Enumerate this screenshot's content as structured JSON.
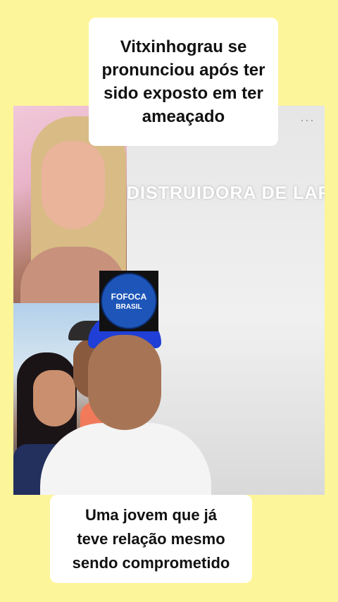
{
  "headline": {
    "lines": [
      "Vitxinhograu se",
      "pronunciou após ter",
      "sido exposto em ter",
      "ameaçado"
    ]
  },
  "video": {
    "wall_text": "DISTRUIDORA DE LAR.",
    "menu_icon": "more-dots-icon",
    "menu_glyph": "···"
  },
  "logo": {
    "line1": "FOFOCA",
    "line2": "BRASIL"
  },
  "caption": {
    "lines": [
      "Uma jovem que já",
      "teve relação mesmo",
      "sendo comprometido"
    ]
  },
  "colors": {
    "background": "#fdf59a",
    "text_box": "#ffffff",
    "logo_blue": "#1d56b8"
  }
}
